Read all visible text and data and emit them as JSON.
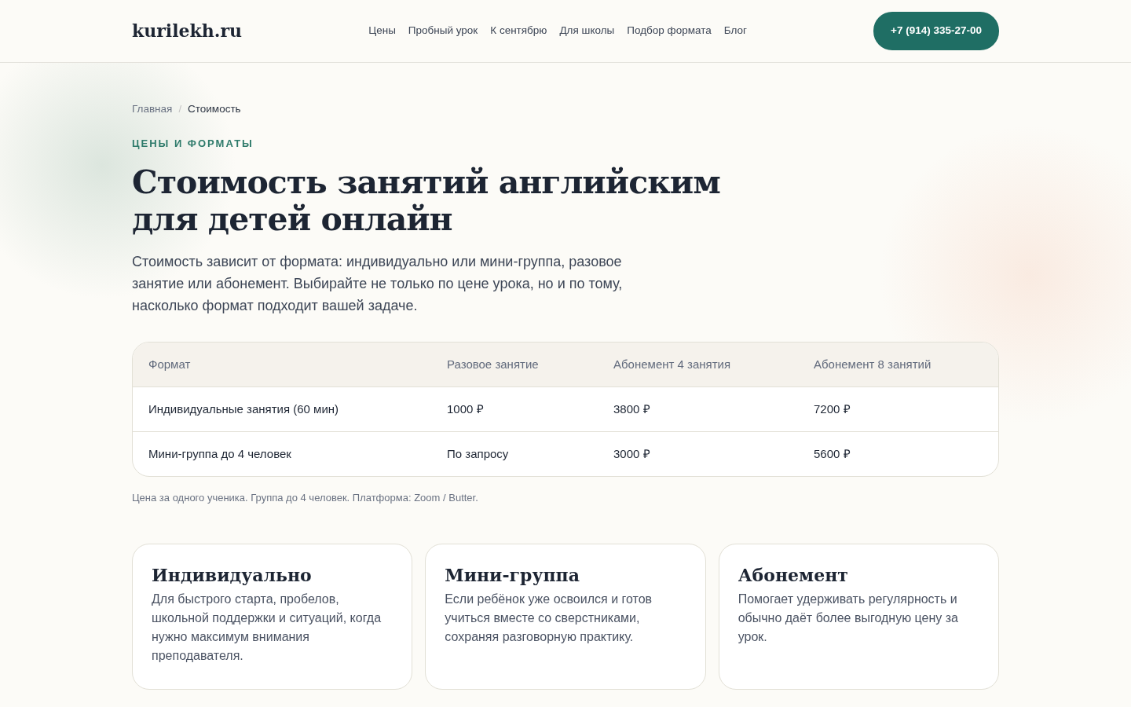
{
  "header": {
    "logo": "kurilekh.ru",
    "nav": [
      {
        "label": "Цены"
      },
      {
        "label": "Пробный урок"
      },
      {
        "label": "К сентябрю"
      },
      {
        "label": "Для школы"
      },
      {
        "label": "Подбор формата"
      },
      {
        "label": "Блог"
      }
    ],
    "phone_button": "+7 (914) 335-27-00"
  },
  "breadcrumb": [
    {
      "label": "Главная",
      "current": false
    },
    {
      "label": "Стоимость",
      "current": true
    }
  ],
  "breadcrumb_separator": "/",
  "eyebrow": "ЦЕНЫ И ФОРМАТЫ",
  "title": "Стоимость занятий английским для детей онлайн",
  "lead": "Стоимость зависит от формата: индивидуально или мини-группа, разовое занятие или абонемент. Выбирайте не только по цене урока, но и по тому, насколько формат подходит вашей задаче.",
  "table": {
    "columns": [
      "Формат",
      "Разовое занятие",
      "Абонемент 4 занятия",
      "Абонемент 8 занятий"
    ],
    "rows": [
      [
        "Индивидуальные занятия (60 мин)",
        "1000 ₽",
        "3800 ₽",
        "7200 ₽"
      ],
      [
        "Мини-группа до 4 человек",
        "По запросу",
        "3000 ₽",
        "5600 ₽"
      ]
    ]
  },
  "table_note": "Цена за одного ученика. Группа до 4 человек. Платформа: Zoom / Butter.",
  "cards": [
    {
      "title": "Индивидуально",
      "text": "Для быстрого старта, пробелов, школьной поддержки и ситуаций, когда нужно максимум внимания преподавателя."
    },
    {
      "title": "Мини-группа",
      "text": "Если ребёнок уже освоился и готов учиться вместе со сверстниками, сохраняя разговорную практику."
    },
    {
      "title": "Абонемент",
      "text": "Помогает удерживать регулярность и обычно даёт более выгодную цену за урок."
    }
  ]
}
